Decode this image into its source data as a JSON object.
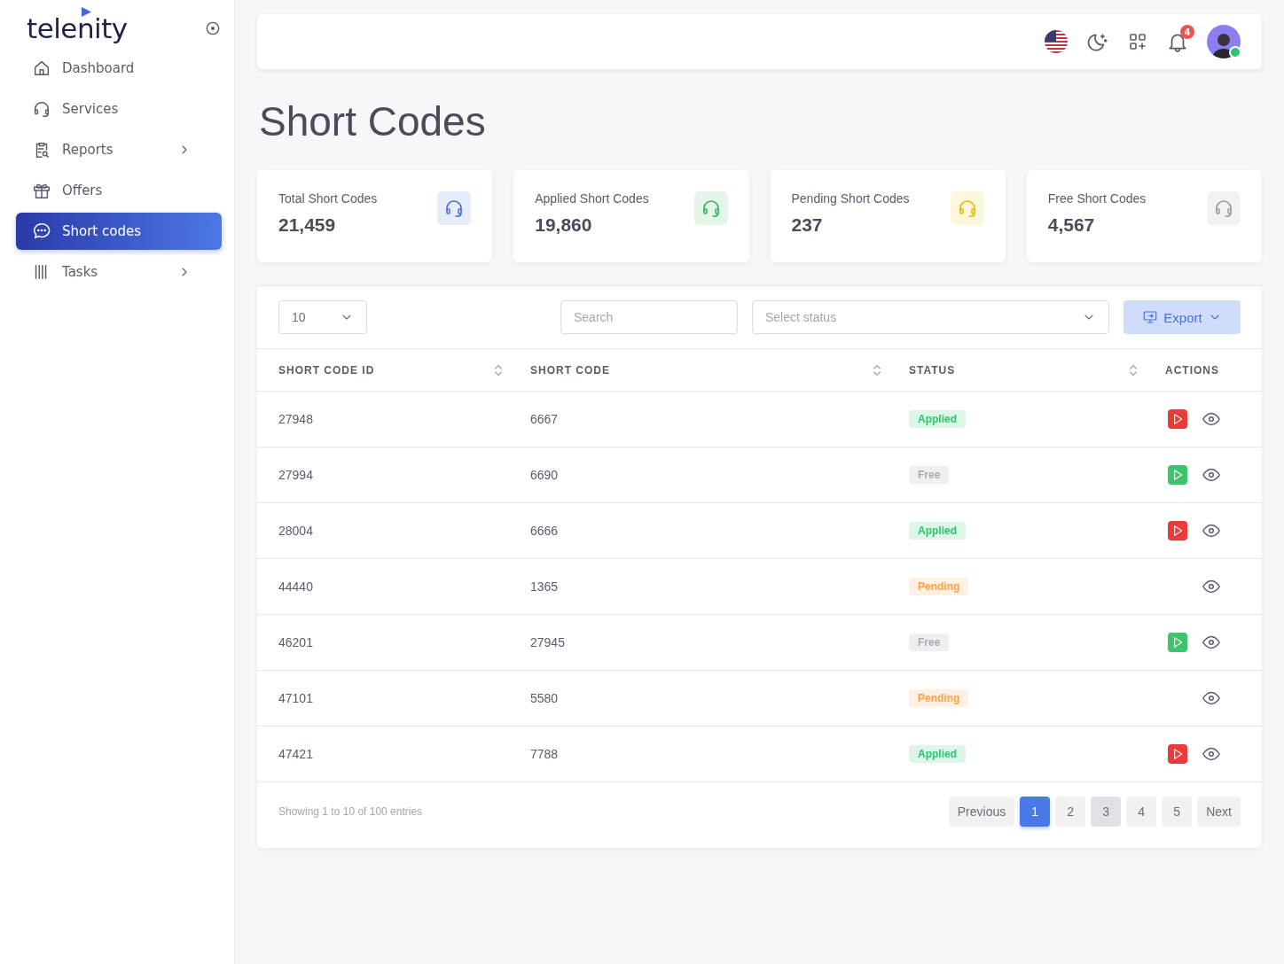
{
  "sidebar": {
    "logo": "telenity",
    "items": [
      {
        "label": "Dashboard",
        "selected": false,
        "expandable": false
      },
      {
        "label": "Services",
        "selected": false,
        "expandable": false
      },
      {
        "label": "Reports",
        "selected": false,
        "expandable": true
      },
      {
        "label": "Offers",
        "selected": false,
        "expandable": false
      },
      {
        "label": "Short codes",
        "selected": true,
        "expandable": false
      },
      {
        "label": "Tasks",
        "selected": false,
        "expandable": true
      }
    ]
  },
  "topbar": {
    "notifications": "4",
    "online": true
  },
  "page_title": "Short Codes",
  "stats": [
    {
      "label": "Total Short Codes",
      "value": "21,459",
      "color": "#4a6fe0"
    },
    {
      "label": "Applied Short Codes",
      "value": "19,860",
      "color": "#2eb85c"
    },
    {
      "label": "Pending Short Codes",
      "value": "237",
      "color": "#e6b800"
    },
    {
      "label": "Free Short Codes",
      "value": "4,567",
      "color": "#9a9a9a"
    }
  ],
  "table": {
    "page_size": "10",
    "search": {
      "placeholder": "Search"
    },
    "status_filter": {
      "placeholder": "Select status"
    },
    "export_label": "Export",
    "columns": [
      {
        "label": "SHORT CODE ID",
        "sortable": true
      },
      {
        "label": "SHORT CODE",
        "sortable": true
      },
      {
        "label": "STATUS",
        "sortable": true
      },
      {
        "label": "ACTIONS",
        "sortable": false
      }
    ],
    "rows": [
      {
        "id": "27948",
        "code": "6667",
        "status": "Applied",
        "kind": "applied",
        "color": "#ea3a3a"
      },
      {
        "id": "27994",
        "code": "6690",
        "status": "Free",
        "kind": "free",
        "color": "#3ec46d"
      },
      {
        "id": "28004",
        "code": "6666",
        "status": "Applied",
        "kind": "applied",
        "color": "#ea3a3a"
      },
      {
        "id": "44440",
        "code": "1365",
        "status": "Pending",
        "kind": "pending"
      },
      {
        "id": "46201",
        "code": "27945",
        "status": "Free",
        "kind": "free",
        "color": "#3ec46d"
      },
      {
        "id": "47101",
        "code": "5580",
        "status": "Pending",
        "kind": "pending"
      },
      {
        "id": "47421",
        "code": "7788",
        "status": "Applied",
        "kind": "applied",
        "color": "#ea3a3a"
      }
    ],
    "summary": "Showing 1 to 10 of 100 entries",
    "pagination": {
      "previous": "Previous",
      "next": "Next",
      "pages": [
        {
          "label": "1",
          "selected": true,
          "hovered": false
        },
        {
          "label": "2",
          "selected": false,
          "hovered": false
        },
        {
          "label": "3",
          "selected": false,
          "hovered": true
        },
        {
          "label": "4",
          "selected": false,
          "hovered": false
        },
        {
          "label": "5",
          "selected": false,
          "hovered": false
        }
      ]
    }
  }
}
